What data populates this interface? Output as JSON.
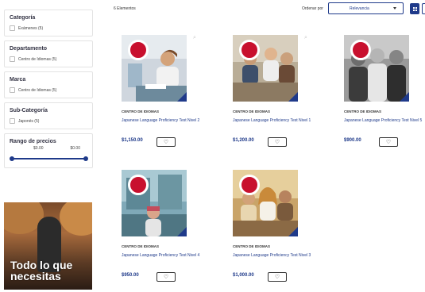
{
  "toolbar": {
    "count_text": "6 Elementos",
    "sort_label": "Ordenar por",
    "sort_value": "Relevancia"
  },
  "filters": [
    {
      "title": "Categoría",
      "option": "Exámenes (5)"
    },
    {
      "title": "Departamento",
      "option": "Centro de Idiomas (5)"
    },
    {
      "title": "Marca",
      "option": "Centro de Idiomas (5)"
    },
    {
      "title": "Sub-Categoría",
      "option": "Japonés (5)"
    }
  ],
  "price_range": {
    "title": "Rango de precios",
    "min": "$0.00",
    "max": "$0.00"
  },
  "promo": {
    "text_line1": "Todo lo que",
    "text_line2": "necesitas"
  },
  "products": [
    {
      "category": "CENTRO DE IDIOMAS",
      "title": "Japanese Language Proficiency Test Nivel 2",
      "price": "$1,150.00"
    },
    {
      "category": "CENTRO DE IDIOMAS",
      "title": "Japanese Language Proficiency Test Nivel 1",
      "price": "$1,200.00"
    },
    {
      "category": "CENTRO DE IDIOMAS",
      "title": "Japanese Language Proficiency Test Nivel 5",
      "price": "$900.00"
    },
    {
      "category": "CENTRO DE IDIOMAS",
      "title": "Japanese Language Proficiency Test Nivel 4",
      "price": "$950.00"
    },
    {
      "category": "CENTRO DE IDIOMAS",
      "title": "Japanese Language Proficiency Test Nivel 3",
      "price": "$1,000.00"
    }
  ],
  "colors": {
    "brand_blue": "#1f3a8a",
    "badge_red": "#c8102e"
  },
  "icons": {
    "zoom": "magnifier-icon",
    "fav": "heart-icon",
    "sort_caret": "caret-down-icon",
    "grid_view": "grid-icon",
    "list_view": "list-icon"
  }
}
